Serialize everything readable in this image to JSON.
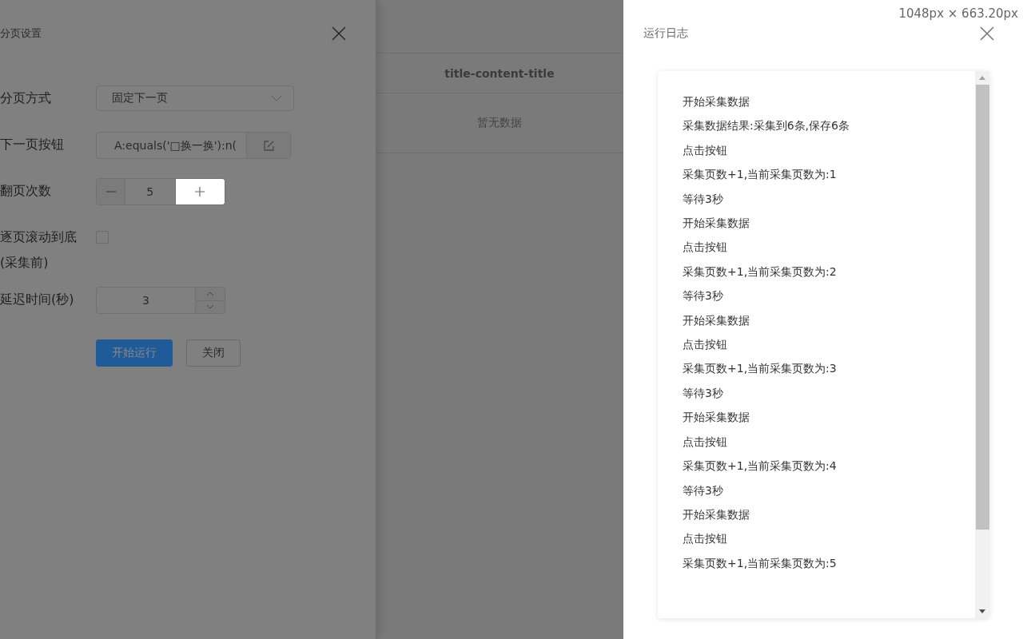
{
  "settings_drawer": {
    "title": "分页设置",
    "fields": [
      {
        "kind": "select",
        "label": "分页方式",
        "value": "固定下一页"
      },
      {
        "kind": "input_button",
        "label": "下一页按钮",
        "value": "A:equals('□换一换'):n("
      },
      {
        "kind": "stepper",
        "label": "翻页次数",
        "value": "5"
      },
      {
        "kind": "checkbox",
        "label": "逐页滚动到底(采集前)",
        "checked": false
      },
      {
        "kind": "spinner",
        "label": "延迟时间(秒)",
        "value": "3"
      }
    ],
    "buttons": [
      {
        "kind": "primary",
        "label": "开始运行"
      },
      {
        "kind": "default",
        "label": "关闭"
      }
    ]
  },
  "table": {
    "columns": [
      "title-content-title"
    ],
    "empty_text": "暂无数据"
  },
  "size_indicator": "1048px × 663.20px",
  "log_drawer": {
    "title": "运行日志",
    "entries": [
      "开始采集数据",
      "采集数据结果:采集到6条,保存6条",
      "点击按钮",
      "采集页数+1,当前采集页数为:1",
      "等待3秒",
      "开始采集数据",
      "点击按钮",
      "采集页数+1,当前采集页数为:2",
      "等待3秒",
      "开始采集数据",
      "点击按钮",
      "采集页数+1,当前采集页数为:3",
      "等待3秒",
      "开始采集数据",
      "点击按钮",
      "采集页数+1,当前采集页数为:4",
      "等待3秒",
      "开始采集数据",
      "点击按钮",
      "采集页数+1,当前采集页数为:5"
    ]
  }
}
